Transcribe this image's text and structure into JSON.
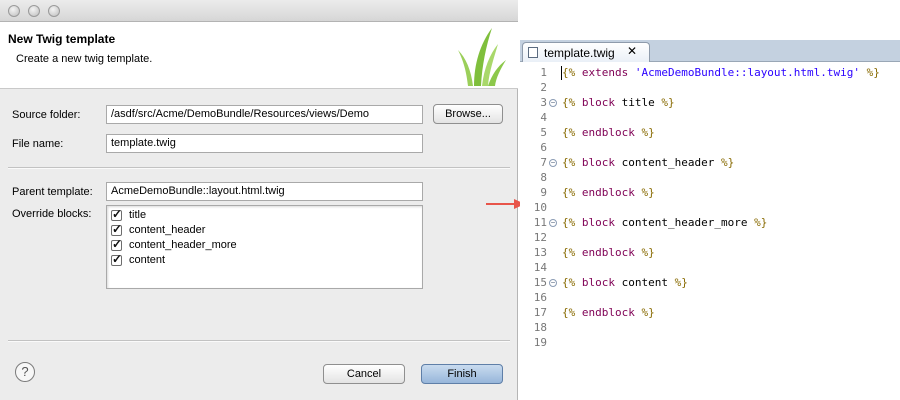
{
  "dialog": {
    "title": "New Twig template",
    "description": "Create a new twig template.",
    "source_folder_label": "Source folder:",
    "source_folder_value": "/asdf/src/Acme/DemoBundle/Resources/views/Demo",
    "browse_label": "Browse...",
    "file_name_label": "File name:",
    "file_name_value": "template.twig",
    "parent_template_label": "Parent template:",
    "parent_template_value": "AcmeDemoBundle::layout.html.twig",
    "override_blocks_label": "Override blocks:",
    "blocks": [
      {
        "label": "title",
        "checked": true
      },
      {
        "label": "content_header",
        "checked": true
      },
      {
        "label": "content_header_more",
        "checked": true
      },
      {
        "label": "content",
        "checked": true
      }
    ],
    "help_label": "?",
    "cancel_label": "Cancel",
    "finish_label": "Finish"
  },
  "editor": {
    "tab_label": "template.twig",
    "tab_close": "✕",
    "lines": [
      {
        "num": "1",
        "fold": false,
        "tokens": [
          [
            "delim",
            "{%"
          ],
          [
            "txt",
            " "
          ],
          [
            "kw",
            "extends"
          ],
          [
            "txt",
            " "
          ],
          [
            "str",
            "'AcmeDemoBundle::layout.html.twig'"
          ],
          [
            "txt",
            " "
          ],
          [
            "delim",
            "%}"
          ]
        ]
      },
      {
        "num": "2",
        "fold": false,
        "tokens": []
      },
      {
        "num": "3",
        "fold": true,
        "tokens": [
          [
            "delim",
            "{%"
          ],
          [
            "txt",
            " "
          ],
          [
            "kw",
            "block"
          ],
          [
            "txt",
            " title "
          ],
          [
            "delim",
            "%}"
          ]
        ]
      },
      {
        "num": "4",
        "fold": false,
        "tokens": []
      },
      {
        "num": "5",
        "fold": false,
        "tokens": [
          [
            "delim",
            "{%"
          ],
          [
            "txt",
            " "
          ],
          [
            "kw",
            "endblock"
          ],
          [
            "txt",
            " "
          ],
          [
            "delim",
            "%}"
          ]
        ]
      },
      {
        "num": "6",
        "fold": false,
        "tokens": []
      },
      {
        "num": "7",
        "fold": true,
        "tokens": [
          [
            "delim",
            "{%"
          ],
          [
            "txt",
            " "
          ],
          [
            "kw",
            "block"
          ],
          [
            "txt",
            " content_header "
          ],
          [
            "delim",
            "%}"
          ]
        ]
      },
      {
        "num": "8",
        "fold": false,
        "tokens": []
      },
      {
        "num": "9",
        "fold": false,
        "tokens": [
          [
            "delim",
            "{%"
          ],
          [
            "txt",
            " "
          ],
          [
            "kw",
            "endblock"
          ],
          [
            "txt",
            " "
          ],
          [
            "delim",
            "%}"
          ]
        ]
      },
      {
        "num": "10",
        "fold": false,
        "tokens": []
      },
      {
        "num": "11",
        "fold": true,
        "tokens": [
          [
            "delim",
            "{%"
          ],
          [
            "txt",
            " "
          ],
          [
            "kw",
            "block"
          ],
          [
            "txt",
            " content_header_more "
          ],
          [
            "delim",
            "%}"
          ]
        ]
      },
      {
        "num": "12",
        "fold": false,
        "tokens": []
      },
      {
        "num": "13",
        "fold": false,
        "tokens": [
          [
            "delim",
            "{%"
          ],
          [
            "txt",
            " "
          ],
          [
            "kw",
            "endblock"
          ],
          [
            "txt",
            " "
          ],
          [
            "delim",
            "%}"
          ]
        ]
      },
      {
        "num": "14",
        "fold": false,
        "tokens": []
      },
      {
        "num": "15",
        "fold": true,
        "tokens": [
          [
            "delim",
            "{%"
          ],
          [
            "txt",
            " "
          ],
          [
            "kw",
            "block"
          ],
          [
            "txt",
            " content "
          ],
          [
            "delim",
            "%}"
          ]
        ]
      },
      {
        "num": "16",
        "fold": false,
        "tokens": []
      },
      {
        "num": "17",
        "fold": false,
        "tokens": [
          [
            "delim",
            "{%"
          ],
          [
            "txt",
            " "
          ],
          [
            "kw",
            "endblock"
          ],
          [
            "txt",
            " "
          ],
          [
            "delim",
            "%}"
          ]
        ]
      },
      {
        "num": "18",
        "fold": false,
        "tokens": []
      },
      {
        "num": "19",
        "fold": false,
        "tokens": []
      }
    ]
  },
  "colors": {
    "arrow": "#e8554a",
    "keyword": "#7f0055",
    "string": "#2a00ff",
    "delimiter": "#886a00"
  },
  "icons": [
    "help-icon",
    "grass-logo-icon",
    "file-icon",
    "close-icon",
    "checkmark-icon",
    "fold-icon",
    "arrow-icon"
  ]
}
